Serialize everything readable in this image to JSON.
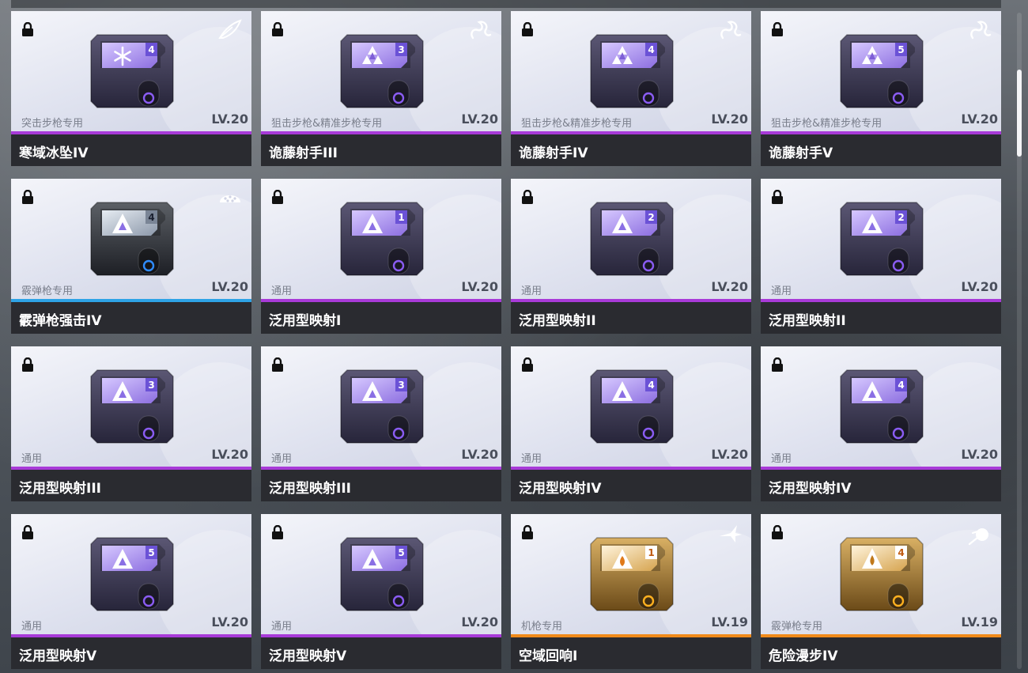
{
  "cards": [
    {
      "name": "寒域冰坠IV",
      "usage": "突击步枪专用",
      "level": "LV.20",
      "rarity": "purple",
      "tier": "4",
      "emblem": "snowflake",
      "corner_icon": "feather-icon"
    },
    {
      "name": "诡藤射手III",
      "usage": "狙击步枪&精准步枪专用",
      "level": "LV.20",
      "rarity": "purple",
      "tier": "3",
      "emblem": "trefoil",
      "corner_icon": "serpent-icon"
    },
    {
      "name": "诡藤射手IV",
      "usage": "狙击步枪&精准步枪专用",
      "level": "LV.20",
      "rarity": "purple",
      "tier": "4",
      "emblem": "trefoil",
      "corner_icon": "serpent-icon"
    },
    {
      "name": "诡藤射手V",
      "usage": "狙击步枪&精准步枪专用",
      "level": "LV.20",
      "rarity": "purple",
      "tier": "5",
      "emblem": "trefoil",
      "corner_icon": "serpent-icon"
    },
    {
      "name": "霰弹枪强击IV",
      "usage": "霰弹枪专用",
      "level": "LV.20",
      "rarity": "blue",
      "tier": "4",
      "emblem": "delta",
      "corner_icon": "pellet-icon"
    },
    {
      "name": "泛用型映射I",
      "usage": "通用",
      "level": "LV.20",
      "rarity": "purple",
      "tier": "1",
      "emblem": "delta",
      "corner_icon": ""
    },
    {
      "name": "泛用型映射II",
      "usage": "通用",
      "level": "LV.20",
      "rarity": "purple",
      "tier": "2",
      "emblem": "delta",
      "corner_icon": ""
    },
    {
      "name": "泛用型映射II",
      "usage": "通用",
      "level": "LV.20",
      "rarity": "purple",
      "tier": "2",
      "emblem": "delta",
      "corner_icon": ""
    },
    {
      "name": "泛用型映射III",
      "usage": "通用",
      "level": "LV.20",
      "rarity": "purple",
      "tier": "3",
      "emblem": "delta",
      "corner_icon": ""
    },
    {
      "name": "泛用型映射III",
      "usage": "通用",
      "level": "LV.20",
      "rarity": "purple",
      "tier": "3",
      "emblem": "delta",
      "corner_icon": ""
    },
    {
      "name": "泛用型映射IV",
      "usage": "通用",
      "level": "LV.20",
      "rarity": "purple",
      "tier": "4",
      "emblem": "delta",
      "corner_icon": ""
    },
    {
      "name": "泛用型映射IV",
      "usage": "通用",
      "level": "LV.20",
      "rarity": "purple",
      "tier": "4",
      "emblem": "delta",
      "corner_icon": ""
    },
    {
      "name": "泛用型映射V",
      "usage": "通用",
      "level": "LV.20",
      "rarity": "purple",
      "tier": "5",
      "emblem": "delta",
      "corner_icon": ""
    },
    {
      "name": "泛用型映射V",
      "usage": "通用",
      "level": "LV.20",
      "rarity": "purple",
      "tier": "5",
      "emblem": "delta",
      "corner_icon": ""
    },
    {
      "name": "空域回响I",
      "usage": "机枪专用",
      "level": "LV.19",
      "rarity": "orange",
      "tier": "1",
      "emblem": "flame",
      "corner_icon": "jet-icon"
    },
    {
      "name": "危险漫步IV",
      "usage": "霰弹枪专用",
      "level": "LV.19",
      "rarity": "orange",
      "tier": "4",
      "emblem": "drop",
      "corner_icon": "comet-icon"
    }
  ],
  "rarity_colors": {
    "purple": "#a83ad8",
    "blue": "#2ea3e6",
    "orange": "#f08a1a"
  },
  "scroll_position": 0.1
}
